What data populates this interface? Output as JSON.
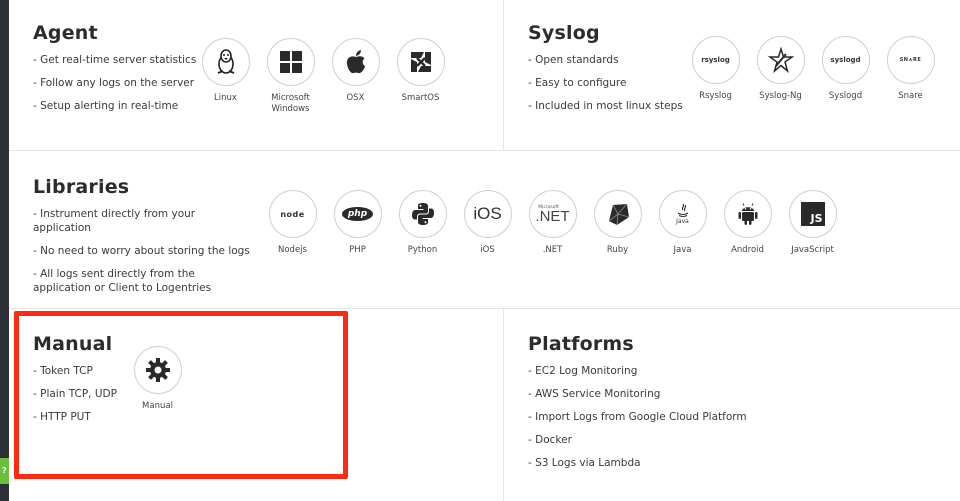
{
  "agent": {
    "title": "Agent",
    "bullets": [
      "- Get real-time server statistics",
      "- Follow any logs on the server",
      "- Setup alerting in real-time"
    ],
    "icons": [
      {
        "label": "Linux",
        "icon": "linux-icon"
      },
      {
        "label": "Microsoft Windows",
        "icon": "windows-icon"
      },
      {
        "label": "OSX",
        "icon": "apple-icon"
      },
      {
        "label": "SmartOS",
        "icon": "smartos-icon"
      }
    ]
  },
  "syslog": {
    "title": "Syslog",
    "bullets": [
      "- Open standards",
      "- Easy to configure",
      "- Included in most linux steps"
    ],
    "icons": [
      {
        "label": "Rsyslog",
        "logo_text": "rsyslog",
        "icon": "rsyslog-icon"
      },
      {
        "label": "Syslog-Ng",
        "icon": "syslog-ng-icon"
      },
      {
        "label": "Syslogd",
        "logo_text": "syslogd",
        "icon": "syslogd-icon"
      },
      {
        "label": "Snare",
        "logo_text": "SN∧RE",
        "icon": "snare-icon"
      }
    ]
  },
  "libraries": {
    "title": "Libraries",
    "bullets": [
      "- Instrument directly from your application",
      "- No need to worry about storing the logs",
      "- All logs sent directly from the application or Client to Logentries"
    ],
    "icons": [
      {
        "label": "Nodejs",
        "logo_text": "node",
        "icon": "nodejs-icon"
      },
      {
        "label": "PHP",
        "logo_text": "php",
        "icon": "php-icon"
      },
      {
        "label": "Python",
        "icon": "python-icon"
      },
      {
        "label": "iOS",
        "logo_text": "iOS",
        "icon": "ios-icon"
      },
      {
        "label": ".NET",
        "logo_text": ".NET",
        "sub_text": "Microsoft",
        "icon": "dotnet-icon"
      },
      {
        "label": "Ruby",
        "icon": "ruby-icon"
      },
      {
        "label": "Java",
        "logo_text": "Java",
        "icon": "java-icon"
      },
      {
        "label": "Android",
        "icon": "android-icon"
      },
      {
        "label": "JavaScript",
        "logo_text": "JS",
        "icon": "javascript-icon"
      }
    ]
  },
  "manual": {
    "title": "Manual",
    "bullets": [
      "- Token TCP",
      "- Plain TCP, UDP",
      "- HTTP PUT"
    ],
    "icons": [
      {
        "label": "Manual",
        "icon": "gear-icon"
      }
    ]
  },
  "platforms": {
    "title": "Platforms",
    "links": [
      "- EC2 Log Monitoring",
      "- AWS Service Monitoring",
      "- Import Logs from Google Cloud Platform",
      "- Docker",
      "- S3 Logs via Lambda"
    ]
  },
  "help_tab": {
    "label": "?"
  },
  "colors": {
    "highlight": "#ff2a12",
    "help_tab": "#6bbf3a"
  }
}
